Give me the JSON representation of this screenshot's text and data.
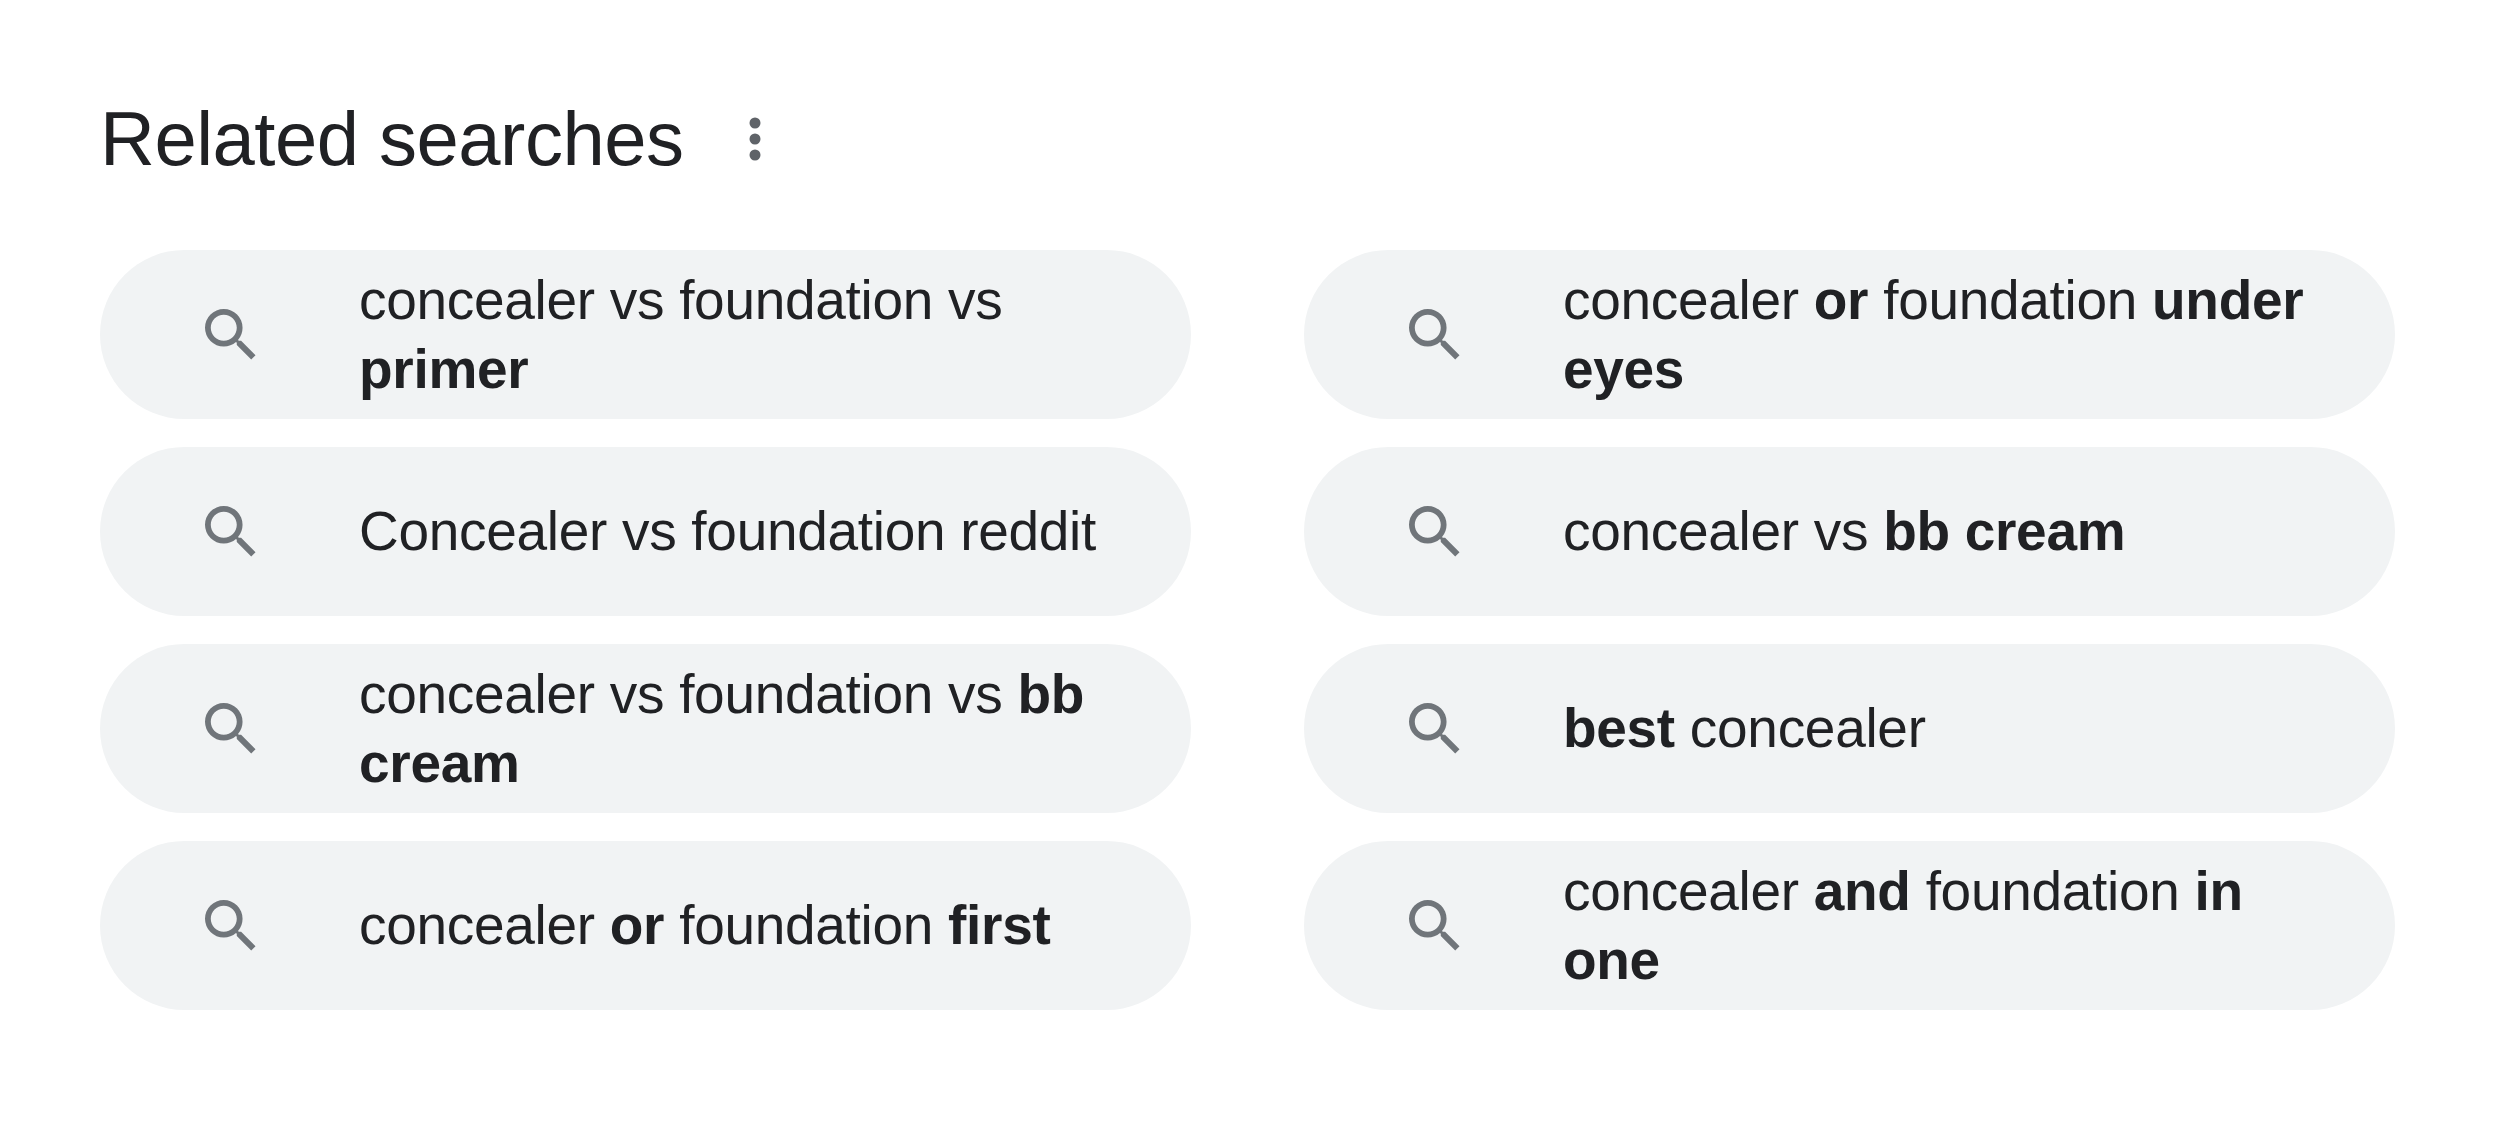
{
  "section": {
    "title": "Related searches"
  },
  "searches": [
    {
      "text": "concealer vs foundation vs **primer**"
    },
    {
      "text": "Concealer vs foundation reddit"
    },
    {
      "text": "concealer vs foundation vs **bb cream**"
    },
    {
      "text": "concealer **or** foundation **first**"
    },
    {
      "text": "concealer **or** foundation **under eyes**"
    },
    {
      "text": "concealer vs **bb cream**"
    },
    {
      "text": "**best** concealer"
    },
    {
      "text": "concealer **and** foundation **in one**"
    }
  ]
}
